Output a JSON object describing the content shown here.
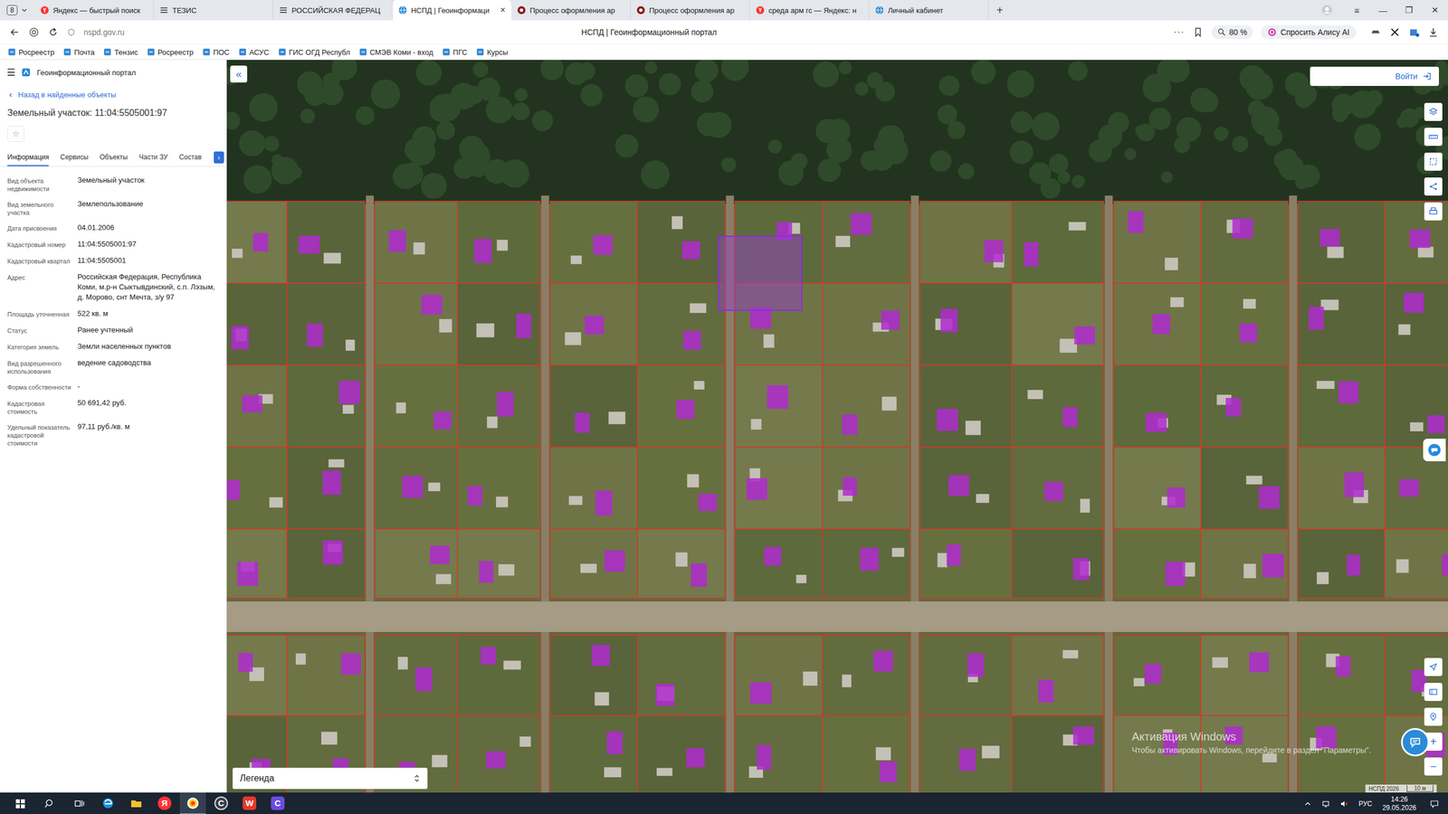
{
  "browser": {
    "tab_counter": "8",
    "tabs": [
      {
        "label": "Яндекс — быстрый поиск",
        "selected": false,
        "kind": "yandex"
      },
      {
        "label": "ТЕЗИС",
        "selected": false,
        "kind": "menu"
      },
      {
        "label": "РОССИЙСКАЯ ФЕДЕРАЦ",
        "selected": false,
        "kind": "menu"
      },
      {
        "label": "НСПД | Геоинформаци",
        "selected": true,
        "kind": "nspd"
      },
      {
        "label": "Процесс оформления ар",
        "selected": false,
        "kind": "process"
      },
      {
        "label": "Процесс оформления ар",
        "selected": false,
        "kind": "process"
      },
      {
        "label": "среда арм гс — Яндекс: н",
        "selected": false,
        "kind": "yandex"
      },
      {
        "label": "Личный кабинет",
        "selected": false,
        "kind": "nspd"
      }
    ],
    "close_tab": "×",
    "new_tab": "+",
    "window_controls": [
      "≡",
      "—",
      "❐",
      "✕"
    ],
    "url": "nspd.gov.ru",
    "page_title": "НСПД | Геоинформационный портал",
    "more": "···",
    "zoom": "80 %",
    "alice": "Спросить Алису AI",
    "bookmarks": [
      "Росреестр",
      "Почта",
      "Тензис",
      "Росреестр",
      "ПОС",
      "АСУС",
      "ГИС ОГД Республ",
      "СМЭВ Коми - вход",
      "ПГС",
      "Курсы"
    ]
  },
  "portal": {
    "menu": "☰",
    "name": "Геоинформационный портал",
    "back": "Назад в найденные объекты",
    "title": "Земельный участок: 11:04:5505001:97",
    "favorite": "☆",
    "tabs": [
      {
        "label": "Информация",
        "selected": true
      },
      {
        "label": "Сервисы",
        "selected": false
      },
      {
        "label": "Объекты",
        "selected": false
      },
      {
        "label": "Части ЗУ",
        "selected": false
      },
      {
        "label": "Состав",
        "selected": false
      }
    ],
    "tabs_more": "›",
    "fields": [
      {
        "label": "Вид объекта недвижимости",
        "value": "Земельный участок"
      },
      {
        "label": "Вид земельного участка",
        "value": "Землепользование"
      },
      {
        "label": "Дата присвоения",
        "value": "04.01.2006"
      },
      {
        "label": "Кадастровый номер",
        "value": "11:04:5505001:97"
      },
      {
        "label": "Кадастровый квартал",
        "value": "11:04:5505001"
      },
      {
        "label": "Адрес",
        "value": "Российская Федерация, Республика Коми, м.р-н Сыктывдинский, с.п. Лэзым, д. Морово, снт Мечта, з/у 97"
      },
      {
        "label": "Площадь уточненная",
        "value": "522 кв. м"
      },
      {
        "label": "Статус",
        "value": "Ранее учтенный"
      },
      {
        "label": "Категория земель",
        "value": "Земли населенных пунктов"
      },
      {
        "label": "Вид разрешенного использования",
        "value": "ведение садоводства"
      },
      {
        "label": "Форма собственности",
        "value": "-"
      },
      {
        "label": "Кадастровая стоимость",
        "value": "50 691,42 руб."
      },
      {
        "label": "Удельный показатель кадастровой стоимости",
        "value": "97,11 руб./кв. м"
      }
    ]
  },
  "map": {
    "collapse": "«",
    "login": "Войти",
    "legend": "Легенда",
    "zoom_in": "+",
    "zoom_out": "−",
    "selected_parcel_highlighted": true,
    "attribution": "НСПД 2026",
    "scale": "10 м",
    "watermark": {
      "title": "Активация Windows",
      "text": "Чтобы активировать Windows, перейдите в раздел \"Параметры\"."
    }
  },
  "taskbar": {
    "apps": [
      {
        "kind": "edge",
        "glyph": "",
        "selected": false
      },
      {
        "kind": "explorer",
        "glyph": "",
        "selected": false
      },
      {
        "kind": "yandex",
        "glyph": "Я",
        "selected": false
      },
      {
        "kind": "ybrowser",
        "glyph": "",
        "selected": true
      },
      {
        "kind": "circle",
        "glyph": "C",
        "selected": false
      },
      {
        "kind": "wps",
        "glyph": "W",
        "selected": false
      },
      {
        "kind": "purple",
        "glyph": "C",
        "selected": false
      }
    ],
    "lang": "РУС",
    "time": "14:26",
    "date": "29.05.2026"
  }
}
